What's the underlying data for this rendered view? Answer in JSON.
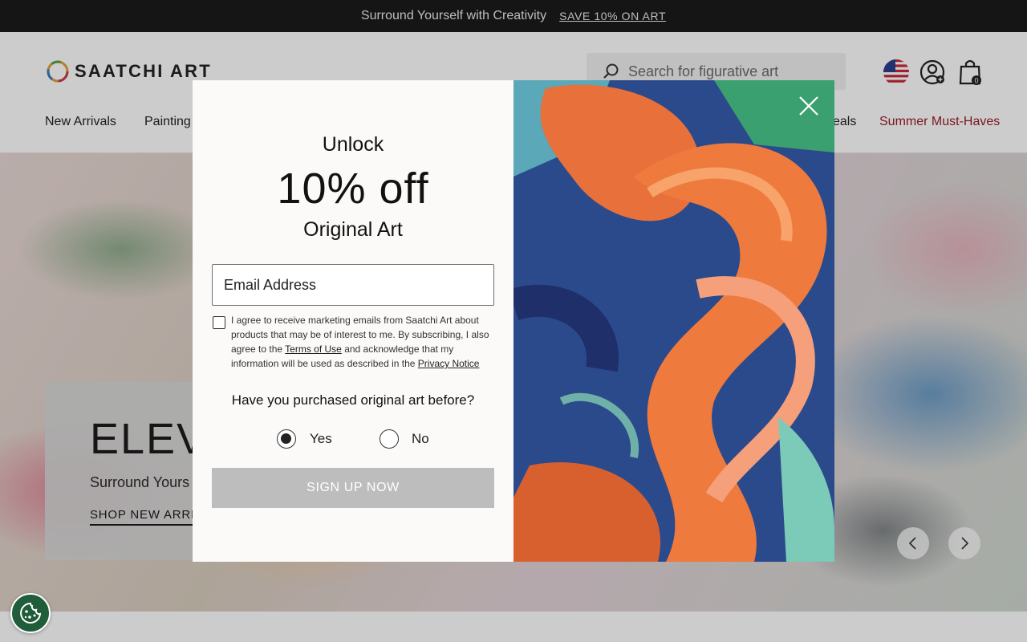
{
  "announcement": {
    "message": "Surround Yourself with Creativity",
    "cta": "SAVE 10% ON ART"
  },
  "header": {
    "logo_text": "SAATCHI ART",
    "search": {
      "placeholder": "Search for figurative art"
    },
    "cart_count": "0",
    "icons": {
      "search": "search-icon",
      "flag": "us-flag-icon",
      "account": "account-icon",
      "cart": "cart-icon"
    }
  },
  "nav": {
    "items": [
      {
        "label": "New Arrivals"
      },
      {
        "label": "Painting"
      },
      {
        "label": "eals"
      },
      {
        "label": "Summer Must-Haves"
      }
    ],
    "highlight_color": "#9b1c2c"
  },
  "hero": {
    "title": "ELEVA",
    "subtitle": "Surround Yours",
    "link": "SHOP NEW ARRIV",
    "icons": {
      "prev": "chevron-left-icon",
      "next": "chevron-right-icon"
    }
  },
  "modal": {
    "heading_top": "Unlock",
    "heading_offer": "10% off",
    "heading_bottom": "Original Art",
    "email_placeholder": "Email Address",
    "consent": {
      "part1": "I agree to receive marketing emails from Saatchi Art about products that may be of interest to me. By subscribing, I also agree to the ",
      "terms_link": "Terms of Use",
      "part2": " and acknowledge that my information will be used as described in the ",
      "privacy_link": "Privacy Notice"
    },
    "question": "Have you purchased original art before?",
    "options": [
      {
        "label": "Yes",
        "selected": true
      },
      {
        "label": "No",
        "selected": false
      }
    ],
    "submit_label": "SIGN UP NOW",
    "icons": {
      "close": "close-icon"
    }
  },
  "cookie": {
    "icon": "cookie-icon"
  },
  "colors": {
    "announce_bg": "#1b1b1b",
    "submit_disabled": "#bdbdbd",
    "cookie_bg": "#1f5d3b"
  }
}
